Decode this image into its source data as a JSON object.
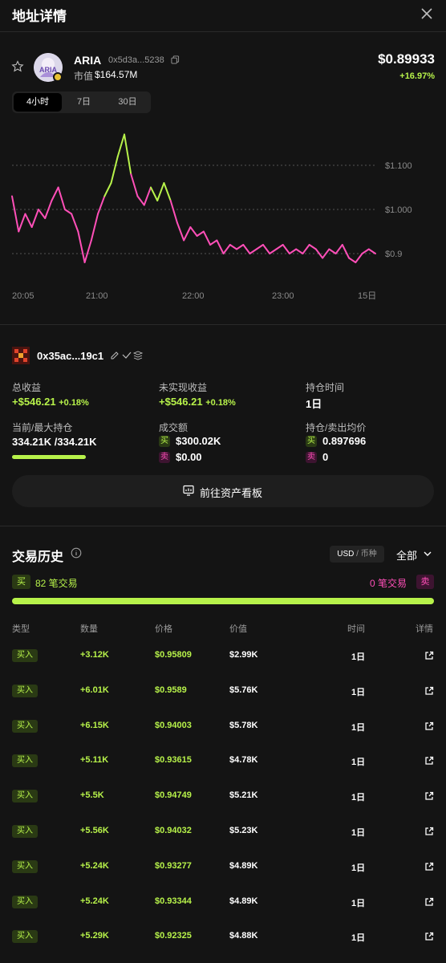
{
  "header": {
    "title": "地址详情"
  },
  "token": {
    "symbol": "ARIA",
    "address": "0x5d3a...5238",
    "mcap_label": "市值",
    "mcap_value": "$164.57M",
    "price": "$0.89933",
    "change": "+16.97%",
    "avatar_text": "ARIA"
  },
  "tabs": [
    "4小时",
    "7日",
    "30日"
  ],
  "chart_data": {
    "type": "line",
    "x_ticks": [
      "20:05",
      "21:00",
      "22:00",
      "23:00",
      "15日"
    ],
    "y_ticks": [
      "$1.100",
      "$1.000",
      "$0.9"
    ],
    "series": [
      {
        "values": [
          1.03,
          0.95,
          0.99,
          0.96,
          1.0,
          0.98,
          1.02,
          1.05,
          1.0,
          0.99,
          0.95,
          0.88,
          0.93,
          0.99,
          1.03,
          1.06,
          1.12,
          1.17,
          1.08,
          1.03,
          1.01,
          1.05,
          1.02,
          1.06,
          1.02,
          0.97,
          0.93,
          0.96,
          0.94,
          0.95,
          0.92,
          0.93,
          0.9,
          0.92,
          0.91,
          0.92,
          0.9,
          0.91,
          0.92,
          0.9,
          0.91,
          0.92,
          0.9,
          0.91,
          0.9,
          0.92,
          0.91,
          0.89,
          0.91,
          0.9,
          0.92,
          0.89,
          0.88,
          0.9,
          0.91,
          0.9
        ]
      }
    ],
    "highlight_color": "#b7f24a",
    "line_color": "#ff4fb8"
  },
  "wallet": {
    "address": "0x35ac...19c1",
    "total_pnl_label": "总收益",
    "total_pnl": "+$546.21",
    "total_pnl_pct": "+0.18%",
    "unrealized_label": "未实现收益",
    "unrealized": "+$546.21",
    "unrealized_pct": "+0.18%",
    "hold_time_label": "持仓时间",
    "hold_time": "1日",
    "holding_label": "当前/最大持仓",
    "holding_cur": "334.21K",
    "holding_max": "/334.21K",
    "holding_ratio": 1.0,
    "volume_label": "成交额",
    "buy_volume": "$300.02K",
    "sell_volume": "$0.00",
    "avg_label": "持仓/卖出均价",
    "buy_avg": "0.897696",
    "sell_avg": "0",
    "buy_tag": "买",
    "sell_tag": "卖",
    "dashboard_button": "前往资产看板"
  },
  "history": {
    "title": "交易历史",
    "currency_usd": "USD",
    "currency_token": "/ 币种",
    "filter": "全部",
    "buy_tag": "买",
    "sell_tag": "卖",
    "buy_count": "82 笔交易",
    "sell_count": "0 笔交易",
    "buy_ratio": 1.0,
    "columns": [
      "类型",
      "数量",
      "价格",
      "价值",
      "时间",
      "详情"
    ],
    "rows": [
      {
        "type": "买入",
        "qty": "+3.12K",
        "price": "$0.95809",
        "value": "$2.99K",
        "time": "1日"
      },
      {
        "type": "买入",
        "qty": "+6.01K",
        "price": "$0.9589",
        "value": "$5.76K",
        "time": "1日"
      },
      {
        "type": "买入",
        "qty": "+6.15K",
        "price": "$0.94003",
        "value": "$5.78K",
        "time": "1日"
      },
      {
        "type": "买入",
        "qty": "+5.11K",
        "price": "$0.93615",
        "value": "$4.78K",
        "time": "1日"
      },
      {
        "type": "买入",
        "qty": "+5.5K",
        "price": "$0.94749",
        "value": "$5.21K",
        "time": "1日"
      },
      {
        "type": "买入",
        "qty": "+5.56K",
        "price": "$0.94032",
        "value": "$5.23K",
        "time": "1日"
      },
      {
        "type": "买入",
        "qty": "+5.24K",
        "price": "$0.93277",
        "value": "$4.89K",
        "time": "1日"
      },
      {
        "type": "买入",
        "qty": "+5.24K",
        "price": "$0.93344",
        "value": "$4.89K",
        "time": "1日"
      },
      {
        "type": "买入",
        "qty": "+5.29K",
        "price": "$0.92325",
        "value": "$4.88K",
        "time": "1日"
      }
    ]
  }
}
